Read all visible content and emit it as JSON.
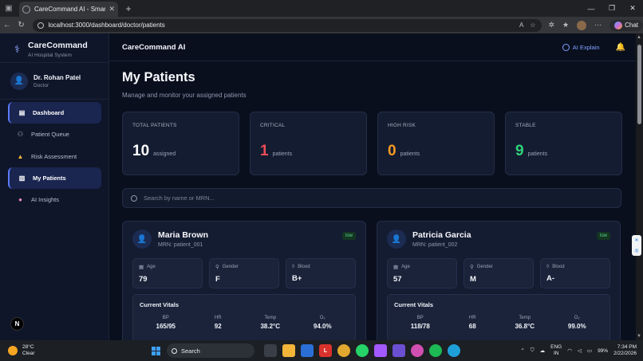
{
  "browser": {
    "tab_title": "CareCommand AI - Smart Digital H",
    "url": "localhost:3000/dashboard/doctor/patients",
    "chat_label": "Chat"
  },
  "sidebar": {
    "brand": "CareCommand",
    "brand_sub": "AI Hospital System",
    "user_name": "Dr. Rohan Patel",
    "user_role": "Doctor",
    "items": [
      {
        "label": "Dashboard",
        "icon": "chart-icon",
        "active": true
      },
      {
        "label": "Patient Queue",
        "icon": "people-icon",
        "active": false
      },
      {
        "label": "Risk Assessment",
        "icon": "warning-icon",
        "active": false
      },
      {
        "label": "My Patients",
        "icon": "clipboard-icon",
        "active": true
      },
      {
        "label": "AI Insights",
        "icon": "brain-icon",
        "active": false
      }
    ],
    "badge_letter": "N"
  },
  "topbar": {
    "app_title": "CareCommand AI",
    "ai_explain": "AI Explain"
  },
  "page": {
    "title": "My Patients",
    "subtitle": "Manage and monitor your assigned patients"
  },
  "stats": [
    {
      "label": "TOTAL PATIENTS",
      "value": "10",
      "unit": "assigned",
      "color": "#ffffff"
    },
    {
      "label": "CRITICAL",
      "value": "1",
      "unit": "patients",
      "color": "#ef4c5a"
    },
    {
      "label": "HIGH RISK",
      "value": "0",
      "unit": "patients",
      "color": "#f59a23"
    },
    {
      "label": "STABLE",
      "value": "9",
      "unit": "patients",
      "color": "#2fd27a"
    }
  ],
  "search": {
    "placeholder": "Search by name or MRN..."
  },
  "patients": [
    {
      "name": "Maria Brown",
      "mrn": "MRN: patient_001",
      "risk": "low",
      "age_label": "Age",
      "age": "79",
      "gender_label": "Gender",
      "gender": "F",
      "blood_label": "Blood",
      "blood": "B+",
      "vitals_title": "Current Vitals",
      "vitals": [
        {
          "label": "BP",
          "value": "165/95"
        },
        {
          "label": "HR",
          "value": "92"
        },
        {
          "label": "Temp",
          "value": "38.2°C"
        },
        {
          "label": "O₂",
          "value": "94.0%"
        }
      ]
    },
    {
      "name": "Patricia Garcia",
      "mrn": "MRN: patient_002",
      "risk": "low",
      "age_label": "Age",
      "age": "57",
      "gender_label": "Gender",
      "gender": "M",
      "blood_label": "Blood",
      "blood": "A-",
      "vitals_title": "Current Vitals",
      "vitals": [
        {
          "label": "BP",
          "value": "118/78"
        },
        {
          "label": "HR",
          "value": "68"
        },
        {
          "label": "Temp",
          "value": "36.8°C"
        },
        {
          "label": "O₂",
          "value": "99.0%"
        }
      ]
    }
  ],
  "taskbar": {
    "temp": "28°C",
    "weather": "Clear",
    "search": "Search",
    "lang1": "ENG",
    "lang2": "IN",
    "battery": "99%",
    "time": "7:34 PM",
    "date": "2/22/2026"
  }
}
